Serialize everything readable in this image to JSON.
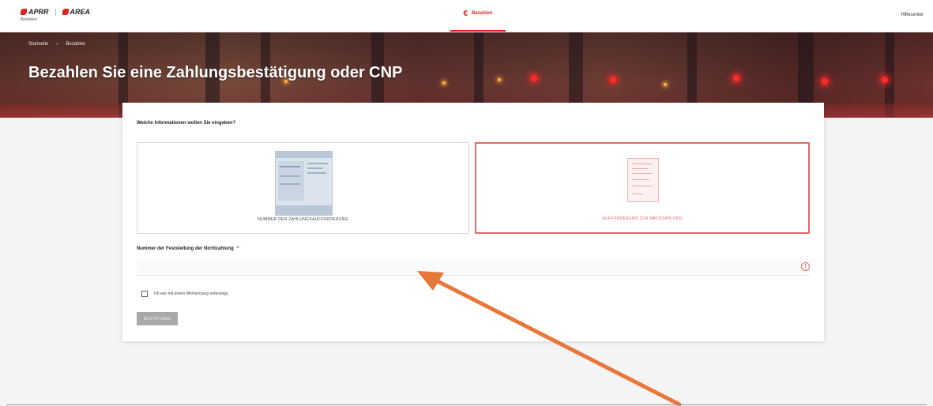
{
  "header": {
    "logo_aprr": "APRR",
    "logo_area": "AREA",
    "logo_subtitle": "Bezahlen",
    "nav_pay_label": "Bezahlen",
    "help_label": "Hilfecenter"
  },
  "hero": {
    "breadcrumb": [
      "Startseite",
      "Bezahlen"
    ],
    "title": "Bezahlen Sie eine Zahlungsbestätigung oder CNP"
  },
  "form": {
    "question": "Welche Informationen wollen Sie eingeben?",
    "options": [
      {
        "label": "NUMMER DER ZAHLUNGSAUFFORDERUNG",
        "selected": false
      },
      {
        "label": "AUFFORDERUNG ZUR NACHZAHLUNG",
        "selected": true
      }
    ],
    "field_label": "Nummer der Feststellung der Nichtzahlung",
    "field_required_mark": "*",
    "field_value": "",
    "checkbox_label": "Ich war mit einem Werfahrzeug unterwegs.",
    "submit_label": "BESTÄTIGEN"
  },
  "colors": {
    "accent": "#d9261c",
    "selected_border": "#e36a6a",
    "annotation_arrow": "#e8773a"
  }
}
